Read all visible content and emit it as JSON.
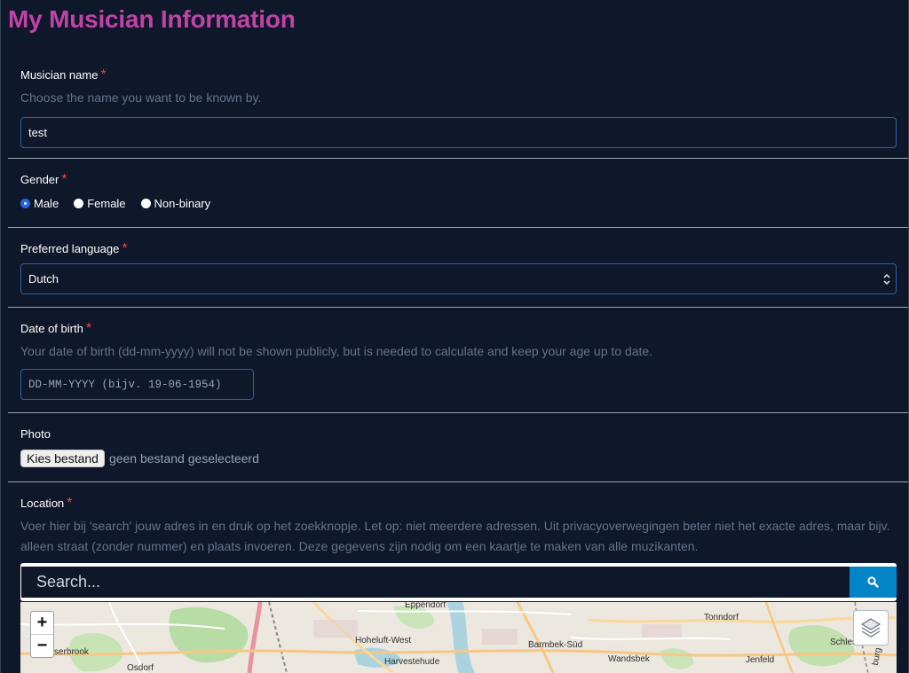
{
  "page": {
    "title": "My Musician Information"
  },
  "musician_name": {
    "label": "Musician name",
    "required": "*",
    "help": "Choose the name you want to be known by.",
    "value": "test"
  },
  "gender": {
    "label": "Gender",
    "required": "*",
    "options": [
      "Male",
      "Female",
      "Non-binary"
    ],
    "selected": "Male"
  },
  "language": {
    "label": "Preferred language",
    "required": "*",
    "selected": "Dutch"
  },
  "dob": {
    "label": "Date of birth",
    "required": "*",
    "help": "Your date of birth (dd-mm-yyyy) will not be shown publicly, but is needed to calculate and keep your age up to date.",
    "placeholder": "DD-MM-YYYY (bijv. 19-06-1954)"
  },
  "photo": {
    "label": "Photo",
    "button_label": "Kies bestand",
    "status": "geen bestand geselecteerd"
  },
  "location": {
    "label": "Location",
    "required": "*",
    "help": "Voer hier bij 'search' jouw adres in en druk op het zoekknopje. Let op: niet meerdere adressen. Uit privacyoverwegingen beter niet het exacte adres, maar bijv. alleen straat (zonder nummer) en plaats invoeren. Deze gegevens zijn nodig om een kaartje te maken van alle muzikanten.",
    "search_placeholder": "Search...",
    "zoom_in": "+",
    "zoom_out": "−",
    "map_labels": [
      "Eppendorf",
      "Tonndorf",
      "Hoheluft-West",
      "Barmbek-Süd",
      "Schles",
      "serbrook",
      "Harvestehude",
      "Wandsbek",
      "Jenfeld",
      "Osdorf",
      "burg"
    ]
  },
  "colors": {
    "title": "#c043a6",
    "background": "#0f172a",
    "input_border": "#2e5fa8",
    "required": "#ef4444",
    "search_button": "#0284c7"
  }
}
